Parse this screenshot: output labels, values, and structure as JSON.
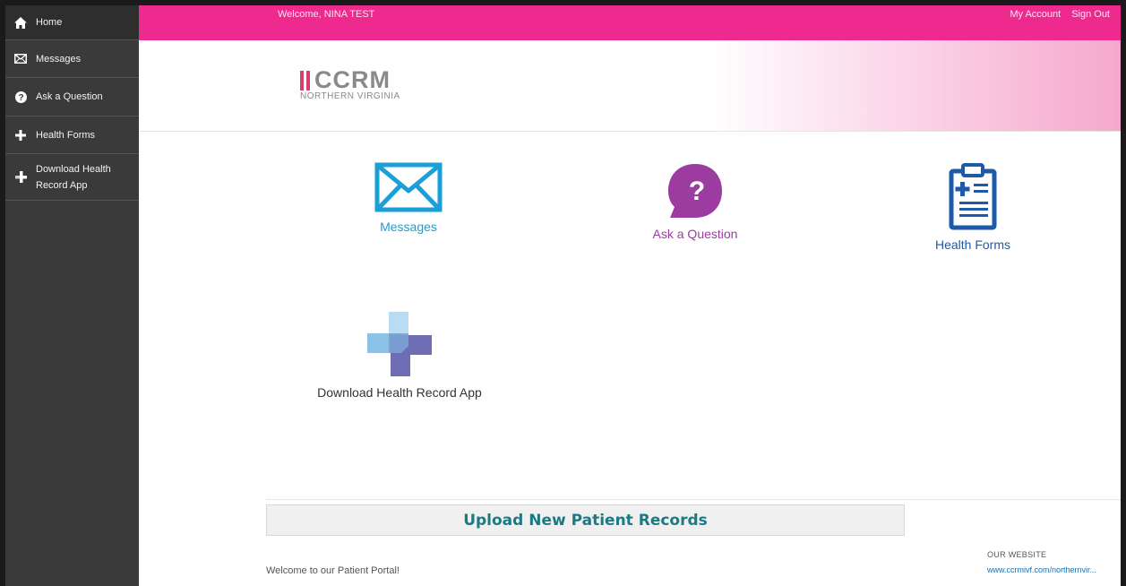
{
  "sidebar": {
    "items": [
      {
        "label": "Home",
        "icon": "home-icon"
      },
      {
        "label": "Messages",
        "icon": "envelope-icon"
      },
      {
        "label": "Ask a Question",
        "icon": "question-circle-icon"
      },
      {
        "label": "Health Forms",
        "icon": "plus-icon"
      },
      {
        "label": "Download Health Record App",
        "icon": "cross-download-icon"
      }
    ]
  },
  "topbar": {
    "welcome": "Welcome, NINA TEST",
    "my_account": "My Account",
    "sign_out": "Sign Out",
    "color": "#ee2a8e"
  },
  "header": {
    "logo_text": "CCRM",
    "logo_subtitle": "NORTHERN VIRGINIA",
    "logo_bar_color": "#d43f6c"
  },
  "tiles": [
    {
      "label": "Messages",
      "icon": "envelope-icon",
      "color": "#1a9fd6"
    },
    {
      "label": "Ask a Question",
      "icon": "question-bubble-icon",
      "color": "#9c3ba0"
    },
    {
      "label": "Health Forms",
      "icon": "clipboard-icon",
      "color": "#1e5aa7"
    },
    {
      "label": "Download Health Record App",
      "icon": "health-cross-icon",
      "color": "#333333"
    }
  ],
  "upload": {
    "label": "Upload New Patient Records",
    "color": "#1b7a84"
  },
  "footer": {
    "welcome": "Welcome to our Patient Portal!",
    "website_heading": "OUR WEBSITE",
    "website_link": "www.ccrmivf.com/northernvir..."
  }
}
